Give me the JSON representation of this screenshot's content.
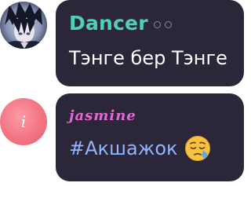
{
  "messages": [
    {
      "author": "Dancer",
      "author_color": "#4fd0b6",
      "text": "Тэнге бер Тэнге",
      "avatar": "anime-character-avatar"
    },
    {
      "author": "jasmine",
      "author_color": "#e36ad6",
      "text": "#Акшажок",
      "text_color": "#93b5ff",
      "avatar": "pink-circle-avatar",
      "avatar_letter": "i",
      "emoji": "sleepy-face-emoji"
    }
  ],
  "colors": {
    "bubble_bg": "#2b2738",
    "avatar_pink": "#f27483"
  }
}
